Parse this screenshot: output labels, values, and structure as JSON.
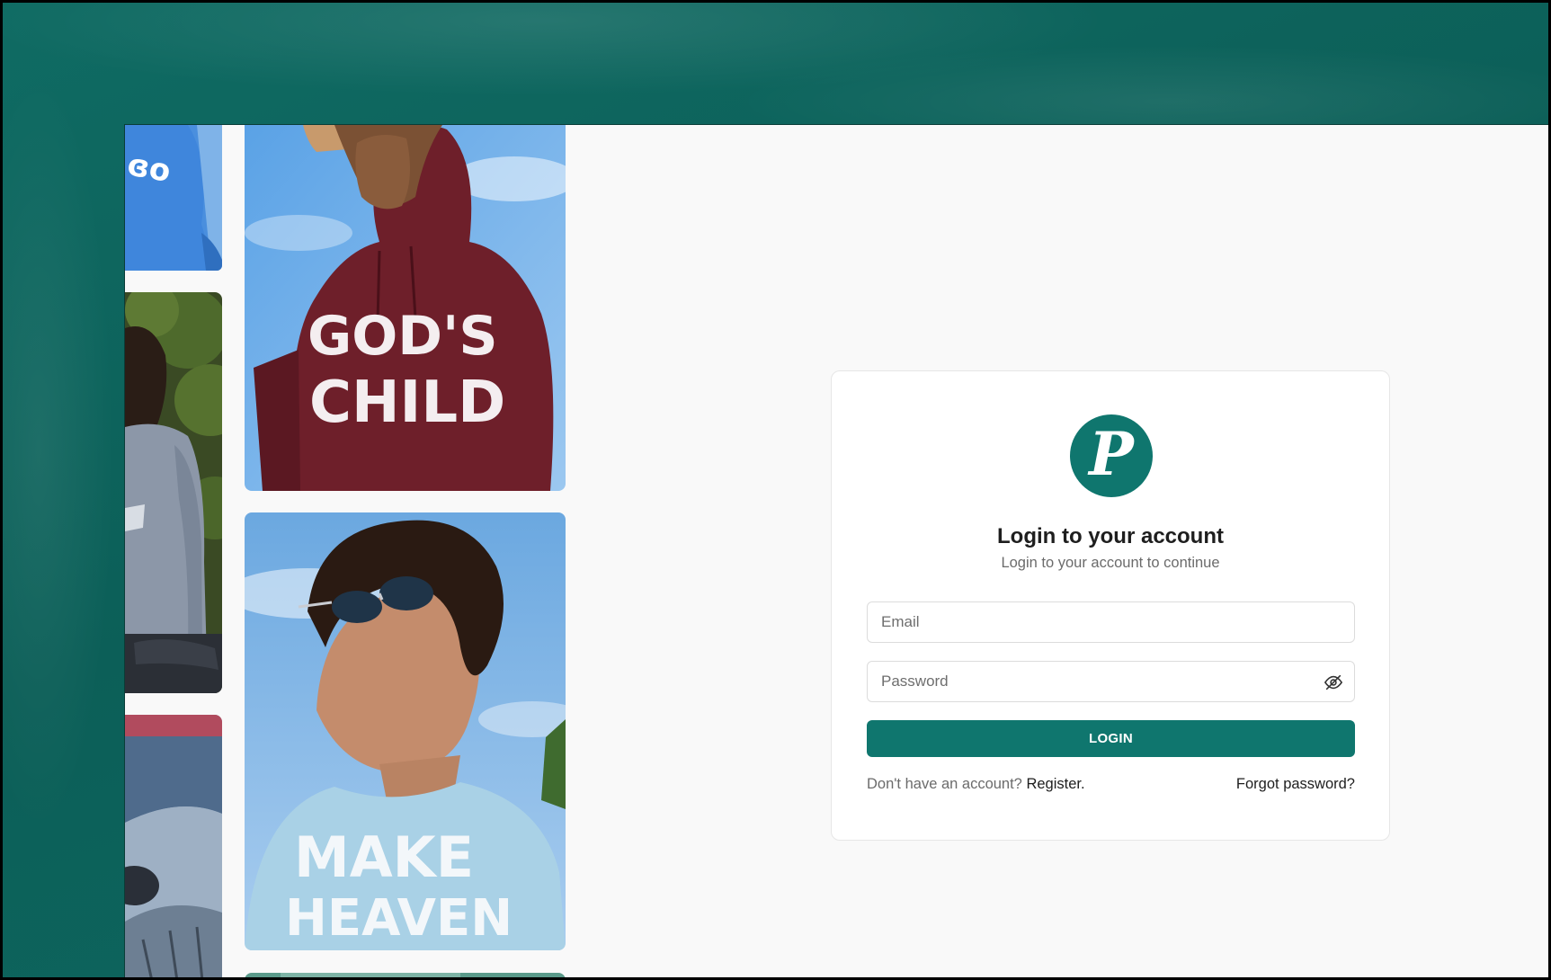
{
  "logo": {
    "letter": "P",
    "color": "#0f766e"
  },
  "login": {
    "title": "Login to your account",
    "subtitle": "Login to your account to continue",
    "email_placeholder": "Email",
    "email_value": "",
    "password_placeholder": "Password",
    "password_value": "",
    "password_toggle_icon": "eye-off-icon",
    "submit_label": "LOGIN",
    "no_account_text": "Don't have an account?",
    "register_link": "Register.",
    "forgot_link": "Forgot password?"
  },
  "gallery": {
    "hoodie_print": [
      "GOD'S",
      "CHILD"
    ],
    "tshirt_print": [
      "MAKE",
      "HEAVEN"
    ]
  },
  "colors": {
    "accent": "#0f766e",
    "backdrop": "#0c5f58",
    "page_background": "#f9f9f9"
  }
}
